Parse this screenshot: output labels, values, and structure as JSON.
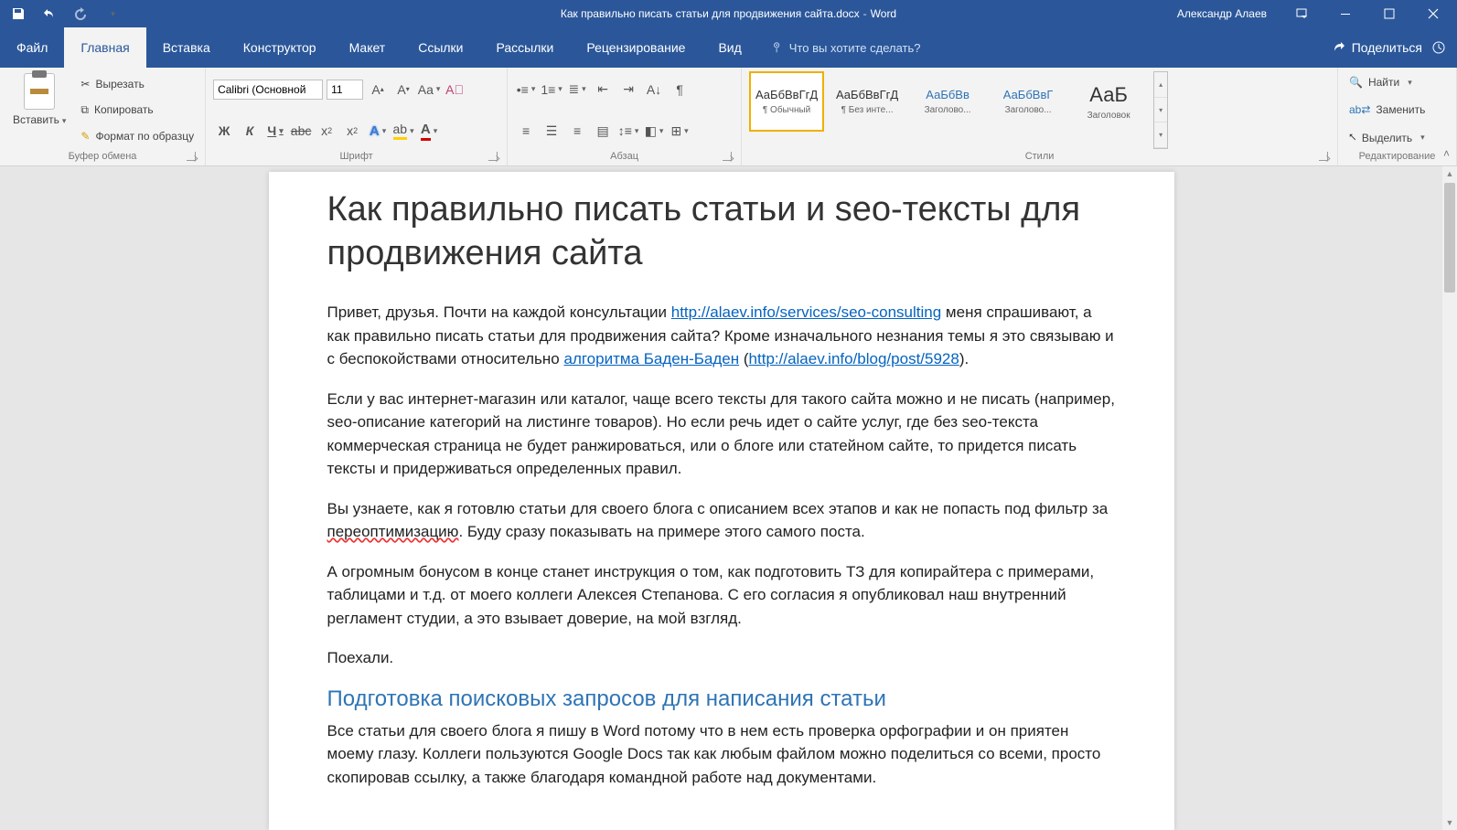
{
  "titlebar": {
    "doc_name": "Как правильно писать статьи для продвижения сайта.docx",
    "app_name": "Word",
    "user": "Александр Алаев"
  },
  "tabs": {
    "file": "Файл",
    "home": "Главная",
    "insert": "Вставка",
    "design": "Конструктор",
    "layout": "Макет",
    "references": "Ссылки",
    "mailings": "Рассылки",
    "review": "Рецензирование",
    "view": "Вид",
    "tellme": "Что вы хотите сделать?",
    "share": "Поделиться"
  },
  "ribbon": {
    "clipboard": {
      "paste": "Вставить",
      "cut": "Вырезать",
      "copy": "Копировать",
      "format_painter": "Формат по образцу",
      "label": "Буфер обмена"
    },
    "font": {
      "name": "Calibri (Основной",
      "size": "11",
      "label": "Шрифт",
      "bold": "Ж",
      "italic": "К",
      "underline": "Ч",
      "strike": "abc",
      "sub": "x₂",
      "sup": "x²",
      "case": "Aa",
      "clear": "⌫"
    },
    "paragraph": {
      "label": "Абзац"
    },
    "styles": {
      "label": "Стили",
      "items": [
        {
          "preview": "АаБбВвГгД",
          "name": "¶ Обычный",
          "selected": true,
          "cls": ""
        },
        {
          "preview": "АаБбВвГгД",
          "name": "¶ Без инте...",
          "selected": false,
          "cls": ""
        },
        {
          "preview": "АаБбВв",
          "name": "Заголово...",
          "selected": false,
          "cls": "blue"
        },
        {
          "preview": "АаБбВвГ",
          "name": "Заголово...",
          "selected": false,
          "cls": "blue"
        },
        {
          "preview": "АаБ",
          "name": "Заголовок",
          "selected": false,
          "cls": "big"
        }
      ]
    },
    "editing": {
      "find": "Найти",
      "replace": "Заменить",
      "select": "Выделить",
      "label": "Редактирование"
    }
  },
  "document": {
    "h1": "Как правильно писать статьи и seo-тексты для продвижения сайта",
    "p1a": "Привет, друзья. Почти на каждой консультации ",
    "link1": "http://alaev.info/services/seo-consulting",
    "p1b": " меня спрашивают, а как правильно писать статьи для продвижения сайта? Кроме изначального незнания темы я это связываю и с беспокойствами относительно ",
    "link2": "алгоритма Баден-Баден",
    "p1c": " (",
    "link3": "http://alaev.info/blog/post/5928",
    "p1d": ").",
    "p2": "Если у вас интернет-магазин или каталог, чаще всего тексты для такого сайта можно и не писать (например, seo-описание категорий на листинге товаров). Но если речь идет о сайте услуг, где без seo-текста коммерческая страница не будет ранжироваться, или о блоге или статейном сайте, то придется писать тексты и придерживаться определенных правил.",
    "p3a": "Вы узнаете, как я готовлю статьи для своего блога с описанием всех этапов и как не попасть под фильтр за ",
    "p3err": "переоптимизацию",
    "p3b": ". Буду сразу показывать на примере этого самого поста.",
    "p4": "А огромным бонусом в конце станет инструкция о том, как подготовить ТЗ для копирайтера с примерами, таблицами и т.д. от моего коллеги Алексея Степанова. С его согласия я опубликовал наш внутренний регламент студии, а это взывает доверие, на мой взгляд.",
    "p5": "Поехали.",
    "h2": "Подготовка поисковых запросов для написания статьи",
    "p6": "Все статьи для своего блога я пишу в Word потому что в нем есть проверка орфографии и он приятен моему глазу. Коллеги пользуются Google Docs так как любым файлом можно поделиться со всеми, просто скопировав ссылку, а также благодаря командной работе над документами."
  }
}
